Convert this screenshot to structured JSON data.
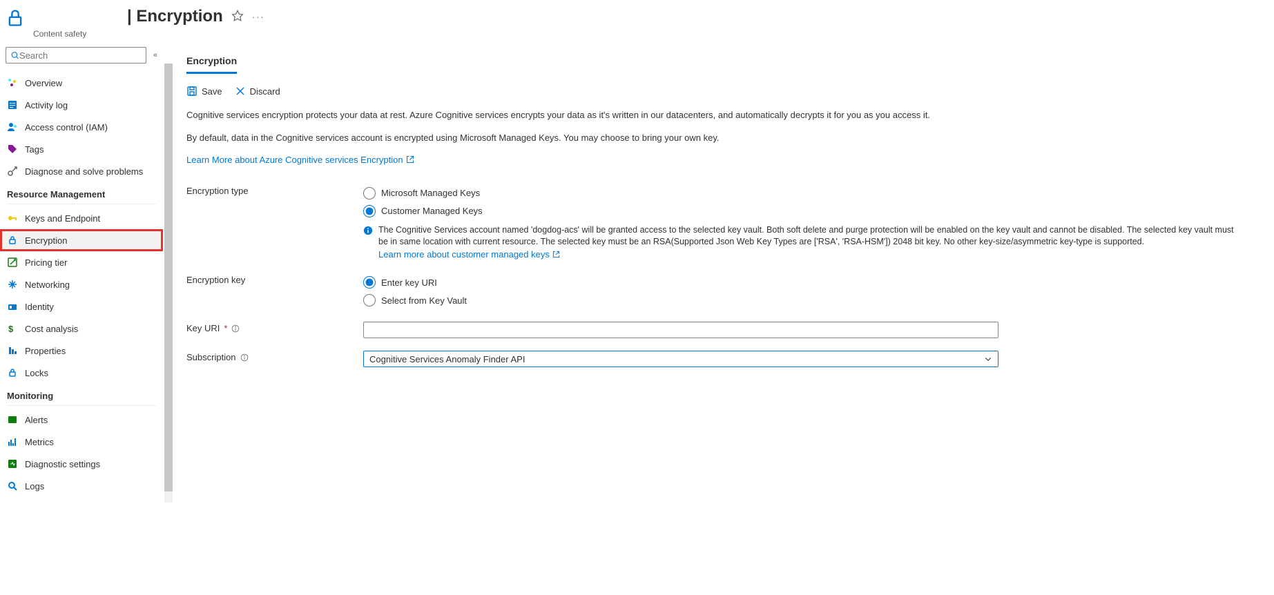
{
  "header": {
    "title_prefix": "| ",
    "title": "Encryption",
    "subtitle": "Content safety"
  },
  "sidebar": {
    "search_placeholder": "Search",
    "top_items": [
      {
        "label": "Overview"
      },
      {
        "label": "Activity log"
      },
      {
        "label": "Access control (IAM)"
      },
      {
        "label": "Tags"
      },
      {
        "label": "Diagnose and solve problems"
      }
    ],
    "groups": [
      {
        "title": "Resource Management",
        "items": [
          {
            "label": "Keys and Endpoint"
          },
          {
            "label": "Encryption",
            "selected": true,
            "highlighted": true
          },
          {
            "label": "Pricing tier"
          },
          {
            "label": "Networking"
          },
          {
            "label": "Identity"
          },
          {
            "label": "Cost analysis"
          },
          {
            "label": "Properties"
          },
          {
            "label": "Locks"
          }
        ]
      },
      {
        "title": "Monitoring",
        "items": [
          {
            "label": "Alerts"
          },
          {
            "label": "Metrics"
          },
          {
            "label": "Diagnostic settings"
          },
          {
            "label": "Logs"
          }
        ]
      }
    ]
  },
  "main": {
    "tab": "Encryption",
    "toolbar": {
      "save": "Save",
      "discard": "Discard"
    },
    "desc_line1": "Cognitive services encryption protects your data at rest. Azure Cognitive services encrypts your data as it's written in our datacenters, and automatically decrypts it for you as you access it.",
    "desc_line2": "By default, data in the Cognitive services account is encrypted using Microsoft Managed Keys. You may choose to bring your own key.",
    "learn_more": "Learn More about Azure Cognitive services Encryption",
    "form": {
      "encryption_type_label": "Encryption type",
      "encryption_type_options": {
        "microsoft": "Microsoft Managed Keys",
        "customer": "Customer Managed Keys"
      },
      "cmk_info": "The Cognitive Services account named 'dogdog-acs' will be granted access to the selected key vault. Both soft delete and purge protection will be enabled on the key vault and cannot be disabled. The selected key vault must be in same location with current resource. The selected key must be an RSA(Supported Json Web Key Types are ['RSA', 'RSA-HSM']) 2048 bit key. No other key-size/asymmetric key-type is supported.",
      "cmk_learn_more": "Learn more about customer managed keys",
      "encryption_key_label": "Encryption key",
      "encryption_key_options": {
        "uri": "Enter key URI",
        "vault": "Select from Key Vault"
      },
      "key_uri_label": "Key URI",
      "key_uri_value": "",
      "subscription_label": "Subscription",
      "subscription_value": "Cognitive Services Anomaly Finder API"
    }
  }
}
